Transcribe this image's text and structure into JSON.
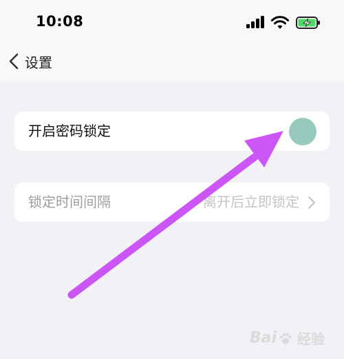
{
  "status_bar": {
    "time": "10:08",
    "icons": [
      "signal-icon",
      "wifi-icon",
      "battery-charging-icon"
    ],
    "battery_color": "#4cd964"
  },
  "nav": {
    "back_label": "设置",
    "back_icon": "chevron-left-icon"
  },
  "settings": {
    "passcode_lock": {
      "label": "开启密码锁定",
      "toggle_on": false,
      "knob_color": "#98c9bd"
    },
    "lock_interval": {
      "label": "锁定时间间隔",
      "value": "离开后立即锁定",
      "disabled": true
    }
  },
  "annotation": {
    "type": "arrow",
    "color": "#cc55f5",
    "points_to": "passcode-lock-toggle"
  },
  "watermark": {
    "text_left": "Bai",
    "text_right": "经验",
    "icon": "paw-icon"
  }
}
